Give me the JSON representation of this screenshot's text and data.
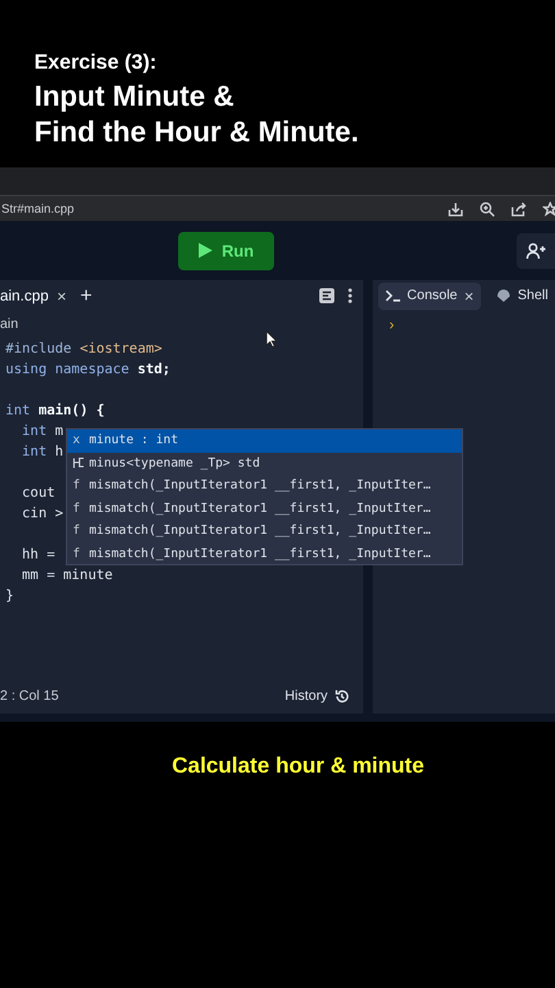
{
  "heading": {
    "label": "Exercise (3):",
    "title_lines": [
      "Input Minute &",
      "Find the Hour & Minute."
    ]
  },
  "browser": {
    "address": "Str#main.cpp"
  },
  "toolbar": {
    "run_button": "Run"
  },
  "editor": {
    "tabs": [
      {
        "label": "ain.cpp",
        "close": "×",
        "selected": true
      }
    ],
    "add_tab": "+",
    "breadcrumb": "ain",
    "lines": [
      {
        "kind": "code",
        "tokens": [
          {
            "kind": "preprocessor",
            "text": "#include "
          },
          {
            "kind": "string",
            "text": "<iostream>"
          }
        ]
      },
      {
        "kind": "code",
        "tokens": [
          {
            "kind": "keyword",
            "text": "using namespace "
          },
          {
            "kind": "identifier",
            "text": "std;"
          }
        ]
      },
      {
        "kind": "blank"
      },
      {
        "kind": "code",
        "tokens": [
          {
            "kind": "keyword",
            "text": "int "
          },
          {
            "kind": "identifier",
            "text": "main() {"
          }
        ]
      },
      {
        "kind": "code",
        "tokens": [
          {
            "kind": "keyword",
            "text": "  int "
          },
          {
            "kind": "plain",
            "text": "m"
          }
        ]
      },
      {
        "kind": "code",
        "tokens": [
          {
            "kind": "keyword",
            "text": "  int "
          },
          {
            "kind": "plain",
            "text": "h"
          }
        ]
      },
      {
        "kind": "blank"
      },
      {
        "kind": "code",
        "tokens": [
          {
            "kind": "plain",
            "text": "  cout"
          }
        ]
      },
      {
        "kind": "code",
        "tokens": [
          {
            "kind": "plain",
            "text": "  cin >"
          }
        ]
      },
      {
        "kind": "blank"
      },
      {
        "kind": "code",
        "tokens": [
          {
            "kind": "plain",
            "text": "  hh ="
          }
        ]
      },
      {
        "kind": "code",
        "tokens": [
          {
            "kind": "plain",
            "text": "  mm = minute"
          }
        ]
      },
      {
        "kind": "code",
        "tokens": [
          {
            "kind": "plain",
            "text": "}"
          }
        ]
      }
    ],
    "autocomplete": [
      {
        "kind": "variable",
        "symbol": "x",
        "label": "minute : int",
        "selected": true
      },
      {
        "kind": "template",
        "label": "minus<typename _Tp> std",
        "selected": false
      },
      {
        "kind": "function",
        "symbol": "f",
        "label": "mismatch(_InputIterator1 __first1, _InputIter…",
        "selected": false
      },
      {
        "kind": "function",
        "symbol": "f",
        "label": "mismatch(_InputIterator1 __first1, _InputIter…",
        "selected": false
      },
      {
        "kind": "function",
        "symbol": "f",
        "label": "mismatch(_InputIterator1 __first1, _InputIter…",
        "selected": false
      },
      {
        "kind": "function",
        "symbol": "f",
        "label": "mismatch(_InputIterator1 __first1, _InputIter…",
        "selected": false
      }
    ],
    "status": "2 : Col 15",
    "history": "History"
  },
  "console": {
    "tabs": [
      {
        "kind": "console",
        "label": "Console",
        "close": "×",
        "selected": true
      },
      {
        "kind": "shell",
        "label": "Shell",
        "selected": false
      }
    ],
    "prompt": "›"
  },
  "caption": "Calculate hour & minute"
}
